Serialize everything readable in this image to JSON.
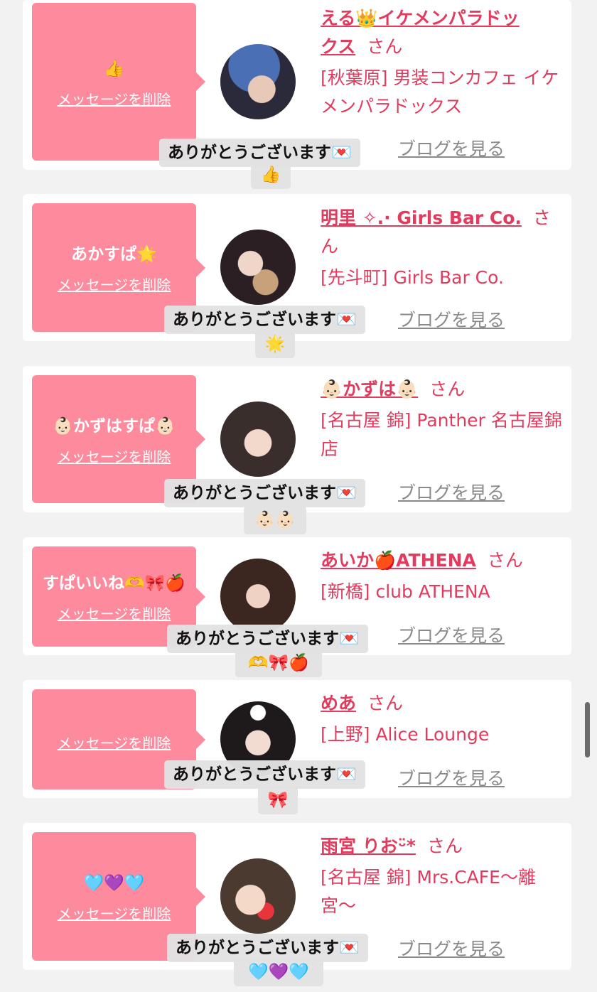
{
  "reply_label": "ありがとうございます💌",
  "delete_label": "メッセージを削除",
  "blog_label": "ブログを見る",
  "san_suffix": "さん",
  "entries": [
    {
      "message": "👍",
      "name_line1": "える👑イケメンパラドッ",
      "name_line2": "クス",
      "shop": "[秋葉原] 男装コンカフェ イケメンパラドックス",
      "reaction": "👍"
    },
    {
      "message": "あかすぱ🌟",
      "name_line1": "明里 ✧.· Girls Bar Co.",
      "name_line2": "",
      "shop": "[先斗町] Girls Bar Co.",
      "reaction": "🌟"
    },
    {
      "message": "👶🏻かずはすぱ👶🏻",
      "name_line1": "👶🏻かずは👶🏻",
      "name_line2": "",
      "shop": "[名古屋 錦] Panther 名古屋錦店",
      "reaction": "👶🏻👶🏻"
    },
    {
      "message": "すぱいいね🫶🎀🍎",
      "name_line1": "あいか🍎ATHENA",
      "name_line2": "",
      "shop": "[新橋] club ATHENA",
      "reaction": "🫶🎀🍎"
    },
    {
      "message": "",
      "name_line1": "めあ",
      "name_line2": "",
      "shop": "[上野] Alice Lounge",
      "reaction": "🎀"
    },
    {
      "message": "🩵💜🩵",
      "name_line1": "雨宮 りおᵕ̈*",
      "name_line2": "",
      "shop": "[名古屋 錦] Mrs.CAFE〜離宮〜",
      "reaction": "🩵💜🩵"
    }
  ]
}
